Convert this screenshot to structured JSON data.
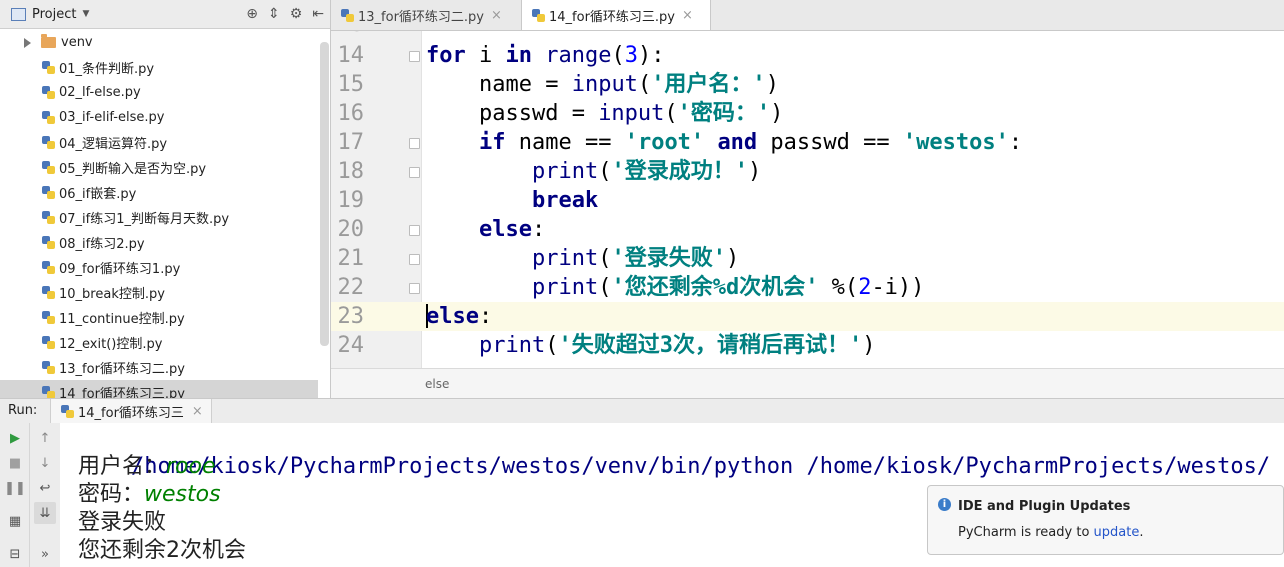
{
  "project": {
    "title": "Project",
    "tree": [
      {
        "label": "venv",
        "type": "folder"
      },
      {
        "label": "01_条件判断.py",
        "type": "file"
      },
      {
        "label": "02_lf-else.py",
        "type": "file"
      },
      {
        "label": "03_if-elif-else.py",
        "type": "file"
      },
      {
        "label": "04_逻辑运算符.py",
        "type": "file"
      },
      {
        "label": "05_判断输入是否为空.py",
        "type": "file"
      },
      {
        "label": "06_if嵌套.py",
        "type": "file"
      },
      {
        "label": "07_if练习1_判断每月天数.py",
        "type": "file"
      },
      {
        "label": "08_if练习2.py",
        "type": "file"
      },
      {
        "label": "09_for循环练习1.py",
        "type": "file"
      },
      {
        "label": "10_break控制.py",
        "type": "file"
      },
      {
        "label": "11_continue控制.py",
        "type": "file"
      },
      {
        "label": "12_exit()控制.py",
        "type": "file"
      },
      {
        "label": "13_for循环练习二.py",
        "type": "file"
      },
      {
        "label": "14_for循环练习三.py",
        "type": "file"
      }
    ]
  },
  "tabs": [
    {
      "label": "13_for循环练习二.py"
    },
    {
      "label": "14_for循环练习三.py"
    }
  ],
  "editor": {
    "stub_line": "13",
    "lines": [
      {
        "n": "14",
        "tokens": [
          [
            "kw",
            "for"
          ],
          [
            "",
            " i "
          ],
          [
            "kw",
            "in"
          ],
          [
            "",
            " "
          ],
          [
            "fn",
            "range"
          ],
          [
            "",
            "("
          ],
          [
            "num",
            "3"
          ],
          [
            "",
            "):"
          ]
        ]
      },
      {
        "n": "15",
        "tokens": [
          [
            "",
            "    name = "
          ],
          [
            "fn",
            "input"
          ],
          [
            "",
            "("
          ],
          [
            "str",
            "'用户名：'"
          ],
          [
            "",
            ")"
          ]
        ]
      },
      {
        "n": "16",
        "tokens": [
          [
            "",
            "    passwd = "
          ],
          [
            "fn",
            "input"
          ],
          [
            "",
            "("
          ],
          [
            "str",
            "'密码：'"
          ],
          [
            "",
            ")"
          ]
        ]
      },
      {
        "n": "17",
        "tokens": [
          [
            "",
            "    "
          ],
          [
            "kw",
            "if"
          ],
          [
            "",
            " name == "
          ],
          [
            "str",
            "'root'"
          ],
          [
            "",
            " "
          ],
          [
            "kw",
            "and"
          ],
          [
            "",
            " passwd == "
          ],
          [
            "str",
            "'westos'"
          ],
          [
            "",
            ":"
          ]
        ]
      },
      {
        "n": "18",
        "tokens": [
          [
            "",
            "        "
          ],
          [
            "fn",
            "print"
          ],
          [
            "",
            "("
          ],
          [
            "str",
            "'登录成功！'"
          ],
          [
            "",
            ")"
          ]
        ]
      },
      {
        "n": "19",
        "tokens": [
          [
            "",
            "        "
          ],
          [
            "kw",
            "break"
          ]
        ]
      },
      {
        "n": "20",
        "tokens": [
          [
            "",
            "    "
          ],
          [
            "kw",
            "else"
          ],
          [
            "",
            ":"
          ]
        ]
      },
      {
        "n": "21",
        "tokens": [
          [
            "",
            "        "
          ],
          [
            "fn",
            "print"
          ],
          [
            "",
            "("
          ],
          [
            "str",
            "'登录失败'"
          ],
          [
            "",
            ")"
          ]
        ]
      },
      {
        "n": "22",
        "tokens": [
          [
            "",
            "        "
          ],
          [
            "fn",
            "print"
          ],
          [
            "",
            "("
          ],
          [
            "str",
            "'您还剩余%d次机会'"
          ],
          [
            "",
            " %("
          ],
          [
            "num",
            "2"
          ],
          [
            "",
            "-i))"
          ]
        ]
      },
      {
        "n": "23",
        "tokens": [
          [
            "cursor",
            ""
          ],
          [
            "kw",
            "else"
          ],
          [
            "",
            ":"
          ]
        ]
      },
      {
        "n": "24",
        "tokens": [
          [
            "",
            "    "
          ],
          [
            "fn",
            "print"
          ],
          [
            "",
            "("
          ],
          [
            "str",
            "'失败超过3次，请稍后再试！'"
          ],
          [
            "",
            ")"
          ]
        ]
      }
    ],
    "current_line": "23"
  },
  "breadcrumb": "else",
  "run": {
    "label": "Run:",
    "tab": "14_for循环练习三",
    "output": {
      "command": "/home/kiosk/PycharmProjects/westos/venv/bin/python /home/kiosk/PycharmProjects/westos/",
      "prompt_user": "用户名：",
      "input_user": "rooe",
      "prompt_pass": "密码：",
      "input_pass": "westos",
      "line_fail": "登录失败",
      "line_remaining": "您还剩余2次机会"
    }
  },
  "notification": {
    "title": "IDE and Plugin Updates",
    "body_prefix": "PyCharm is ready to ",
    "link": "update",
    "body_suffix": "."
  }
}
